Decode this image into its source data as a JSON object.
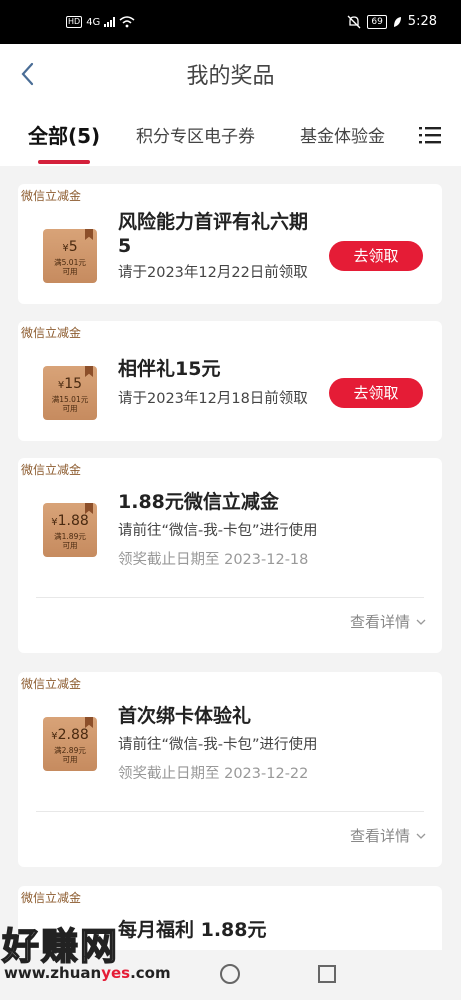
{
  "status_bar": {
    "hd": "HD",
    "network": "4G",
    "battery": "69",
    "time": "5:28"
  },
  "header": {
    "title": "我的奖品"
  },
  "tabs": [
    {
      "label": "全部(5)"
    },
    {
      "label": "积分专区电子券"
    },
    {
      "label": "基金体验金"
    }
  ],
  "cards": [
    {
      "tag": "微信立减金",
      "coupon_amount": "5",
      "coupon_line1": "满5.01元",
      "coupon_line2": "可用",
      "title": "风险能力首评有礼六期5",
      "desc": "请于2023年12月22日前领取",
      "button": "去领取"
    },
    {
      "tag": "微信立减金",
      "coupon_amount": "15",
      "coupon_line1": "满15.01元",
      "coupon_line2": "可用",
      "title": "相伴礼15元",
      "desc": "请于2023年12月18日前领取",
      "button": "去领取"
    },
    {
      "tag": "微信立减金",
      "coupon_amount": "1.88",
      "coupon_line1": "满1.89元",
      "coupon_line2": "可用",
      "title": "1.88元微信立减金",
      "desc": "请前往“微信-我-卡包”进行使用",
      "expire": "领奖截止日期至 2023-12-18",
      "detail": "查看详情"
    },
    {
      "tag": "微信立减金",
      "coupon_amount": "2.88",
      "coupon_line1": "满2.89元",
      "coupon_line2": "可用",
      "title": "首次绑卡体验礼",
      "desc": "请前往“微信-我-卡包”进行使用",
      "expire": "领奖截止日期至 2023-12-22",
      "detail": "查看详情"
    },
    {
      "tag": "微信立减金",
      "title": "每月福利 1.88元"
    }
  ],
  "watermark": {
    "text": "好赚网",
    "url_a": "www.zhuan",
    "url_b": "yes",
    "url_c": ".com"
  },
  "colors": {
    "accent": "#e51c36",
    "tab_underline": "#d4213b",
    "tag_text": "#8c5b2e"
  }
}
